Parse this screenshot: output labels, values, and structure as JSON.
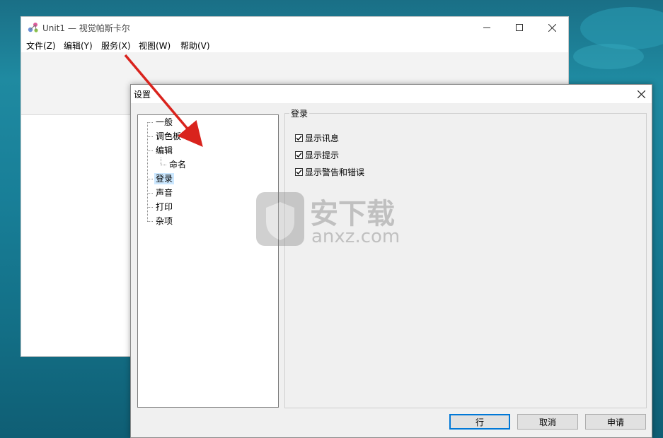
{
  "main_window": {
    "title": "Unit1 — 视觉帕斯卡尔",
    "menu": [
      {
        "label": "文件(Z)"
      },
      {
        "label": "编辑(Y)"
      },
      {
        "label": "服务(X)"
      },
      {
        "label": "视图(W)"
      },
      {
        "label": "帮助(V)"
      }
    ],
    "icons": [
      "molecule-app-icon",
      "minimize-icon",
      "maximize-icon",
      "close-icon"
    ]
  },
  "dialog": {
    "title": "设置",
    "tree": [
      {
        "label": "一般"
      },
      {
        "label": "调色板"
      },
      {
        "label": "编辑"
      },
      {
        "label": "命名"
      },
      {
        "label": "登录",
        "selected": true
      },
      {
        "label": "声音"
      },
      {
        "label": "打印"
      },
      {
        "label": "杂项"
      }
    ],
    "group": {
      "title": "登录",
      "checkboxes": [
        {
          "label": "显示讯息",
          "checked": true
        },
        {
          "label": "显示提示",
          "checked": true
        },
        {
          "label": "显示警告和错误",
          "checked": true
        }
      ]
    },
    "buttons": {
      "ok": "行",
      "cancel": "取消",
      "apply": "申请"
    }
  },
  "watermark": {
    "text_cn": "安下载",
    "text_en": "anxz.com"
  },
  "colors": {
    "accent": "#0078d7",
    "selection": "#cce8ff",
    "annotation_arrow": "#d9231d"
  }
}
